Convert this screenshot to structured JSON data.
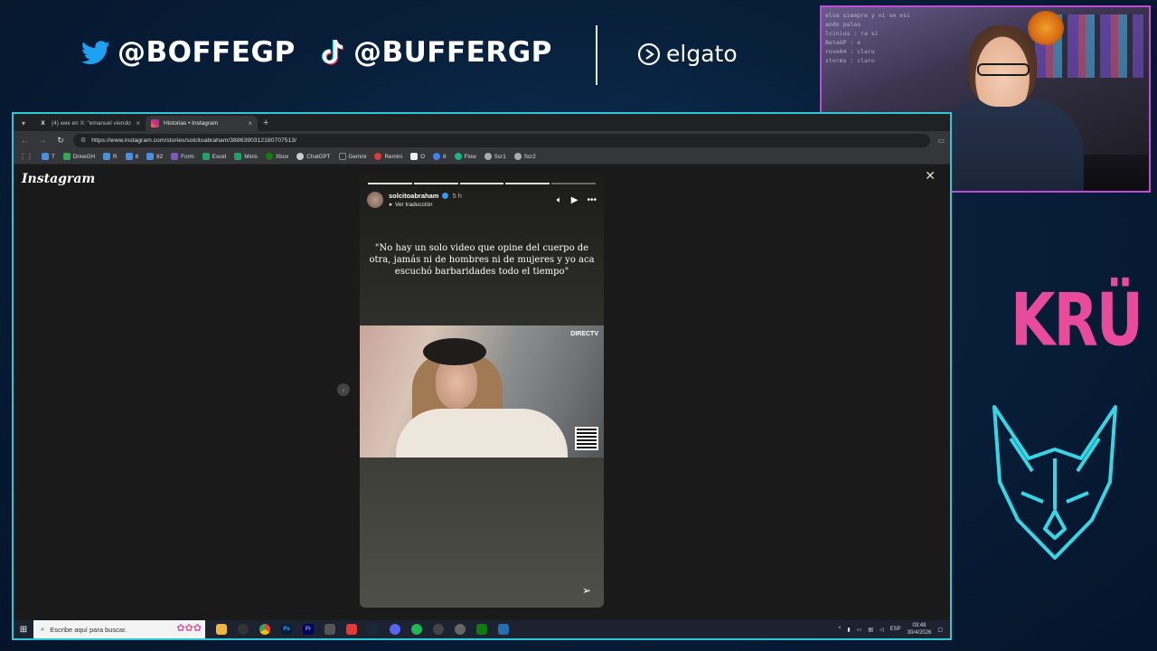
{
  "overlay": {
    "twitter_handle": "@BOFFEGP",
    "tiktok_handle": "@BUFFERGP",
    "sponsor": "elgato",
    "team_logo": "KRÜ",
    "colors": {
      "accent_cyan": "#31c6d6",
      "accent_pink": "#e84a9c",
      "webcam_border": "#c34ad6"
    }
  },
  "webcam": {
    "chat_lines": [
      "elva siempre y ni se esi",
      "ando palas",
      "lcinius : ra si",
      "BetaGP : e",
      "rove04 : claro",
      "storms : claro"
    ]
  },
  "browser": {
    "tabs": [
      {
        "title": "(4) ᴀᴍᴋ en X: \"emanuel viendo o",
        "icon": "x-icon",
        "active": false
      },
      {
        "title": "Historias • Instagram",
        "icon": "instagram-icon",
        "active": true
      }
    ],
    "new_tab_label": "+",
    "url": "https://www.instagram.com/stories/solcitoabraham/3886390312180707513/",
    "bookmarks": [
      {
        "label": "T",
        "color": "#4a90e2"
      },
      {
        "label": "DriveGH",
        "color": "#34a853"
      },
      {
        "label": "R",
        "color": "#4a90e2"
      },
      {
        "label": "8",
        "color": "#4a90e2"
      },
      {
        "label": "82",
        "color": "#4a90e2"
      },
      {
        "label": "Form",
        "color": "#7e57c2"
      },
      {
        "label": "Excel",
        "color": "#21a366"
      },
      {
        "label": "Minis",
        "color": "#21a366"
      },
      {
        "label": "Xbox",
        "color": "#107c10"
      },
      {
        "label": "ChatGPT",
        "color": "#cccccc"
      },
      {
        "label": "Gemini",
        "color": "#333333"
      },
      {
        "label": "Remini",
        "color": "#e53935"
      },
      {
        "label": "O",
        "color": "#eeeeee"
      },
      {
        "label": "8",
        "color": "#3b82f6"
      },
      {
        "label": "Flow",
        "color": "#10b981"
      },
      {
        "label": "Scr1",
        "color": "#aaaaaa"
      },
      {
        "label": "Scr2",
        "color": "#aaaaaa"
      }
    ]
  },
  "instagram": {
    "logo": "Instagram",
    "story": {
      "username": "solcitoabraham",
      "time": "5 h",
      "translate_label": "Ver traducción",
      "segments": 5,
      "quote": "\"No hay un solo video que opine del cuerpo de otra, jamás ni de hombres ni de mujeres y yo aca escuchó barbaridades todo el tiempo\"",
      "video_watermark": "DIRECTV"
    }
  },
  "taskbar": {
    "search_placeholder": "Escribe aquí para buscar.",
    "language": "ESP",
    "time": "03:48",
    "date": "30/4/2026"
  }
}
